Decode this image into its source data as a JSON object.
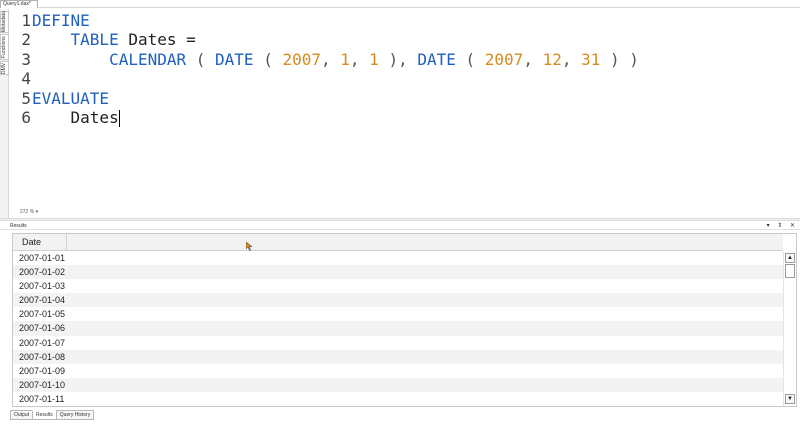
{
  "window": {
    "doc_tab": "Query1.dax*"
  },
  "side_tabs": [
    "Metadata",
    "Functions",
    "DMV"
  ],
  "editor": {
    "line_numbers": [
      "1",
      "2",
      "3",
      "4",
      "5",
      "6"
    ],
    "lines": {
      "l1": {
        "kw": "DEFINE"
      },
      "l2": {
        "indent": "    ",
        "kw": "TABLE",
        "rest": " Dates ="
      },
      "l3": {
        "indent": "        ",
        "fn1": "CALENDAR",
        "p1": " ( ",
        "fn2": "DATE",
        "p2": " ( ",
        "n1": "2007",
        "c1": ", ",
        "n2": "1",
        "c2": ", ",
        "n3": "1",
        "p3": " ), ",
        "fn3": "DATE",
        "p4": " ( ",
        "n4": "2007",
        "c3": ", ",
        "n5": "12",
        "c4": ", ",
        "n6": "31",
        "p5": " ) )"
      },
      "l5": {
        "kw": "EVALUATE"
      },
      "l6": {
        "indent": "    ",
        "text": "Dates"
      }
    },
    "zoom": "272 %"
  },
  "results": {
    "title": "Results",
    "panel_buttons": "▾ ⇕ ✕",
    "column_header": "Date",
    "rows": [
      "2007-01-01",
      "2007-01-02",
      "2007-01-03",
      "2007-01-04",
      "2007-01-05",
      "2007-01-06",
      "2007-01-07",
      "2007-01-08",
      "2007-01-09",
      "2007-01-10",
      "2007-01-11"
    ]
  },
  "bottom_tabs": [
    "Output",
    "Results",
    "Query History"
  ],
  "colors": {
    "keyword": "#1f5fbf",
    "number": "#d98a1f"
  }
}
